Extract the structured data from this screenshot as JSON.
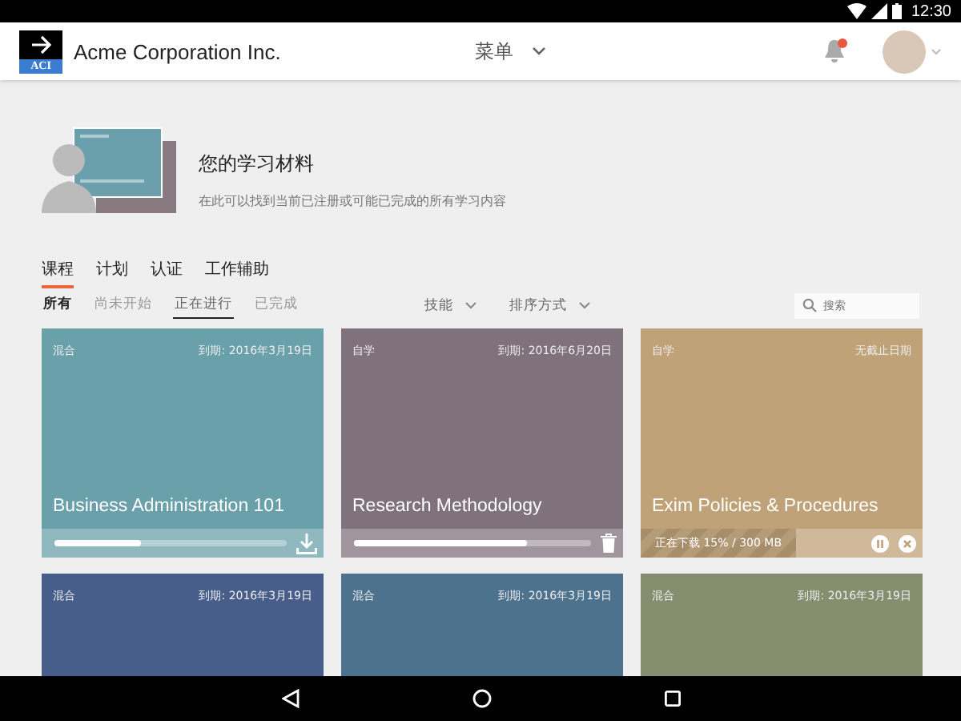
{
  "status_bar": {
    "time": "12:30"
  },
  "header": {
    "logo_text": "ACI",
    "company": "Acme Corporation Inc.",
    "menu": "菜单",
    "has_notification": true
  },
  "hero": {
    "title": "您的学习材料",
    "subtitle": "在此可以找到当前已注册或可能已完成的所有学习内容"
  },
  "tabs": [
    {
      "label": "课程",
      "selected": true
    },
    {
      "label": "计划",
      "selected": false
    },
    {
      "label": "认证",
      "selected": false
    },
    {
      "label": "工作辅助",
      "selected": false
    }
  ],
  "filters": [
    {
      "label": "所有",
      "selected": false,
      "bold": true
    },
    {
      "label": "尚未开始",
      "selected": false,
      "bold": false
    },
    {
      "label": "正在进行",
      "selected": true,
      "bold": false
    },
    {
      "label": "已完成",
      "selected": false,
      "bold": false
    }
  ],
  "dropdowns": [
    "技能",
    "排序方式"
  ],
  "search": {
    "placeholder": "搜索"
  },
  "cards": [
    {
      "type": "混合",
      "due": "到期: 2016年3月19日",
      "title": "Business Administration 101",
      "color": "#6aa0aa",
      "footer": {
        "kind": "downloadable",
        "level": 0.37
      }
    },
    {
      "type": "自学",
      "due": "到期: 2016年6月20日",
      "title": "Research Methodology",
      "color": "#80727c",
      "footer": {
        "kind": "downloaded",
        "level": 0.73
      }
    },
    {
      "type": "自学",
      "due": "无截止日期",
      "title": "Exim Policies & Procedures",
      "color": "#bfa277",
      "footer": {
        "kind": "downloading",
        "level": 0.55,
        "text": "正在下载 15% / 300 MB"
      }
    },
    {
      "type": "混合",
      "due": "到期: 2016年3月19日",
      "color": "#485e8a"
    },
    {
      "type": "混合",
      "due": "到期: 2016年3月19日",
      "color": "#4d728e"
    },
    {
      "type": "混合",
      "due": "到期: 2016年3月19日",
      "color": "#858f70"
    }
  ]
}
